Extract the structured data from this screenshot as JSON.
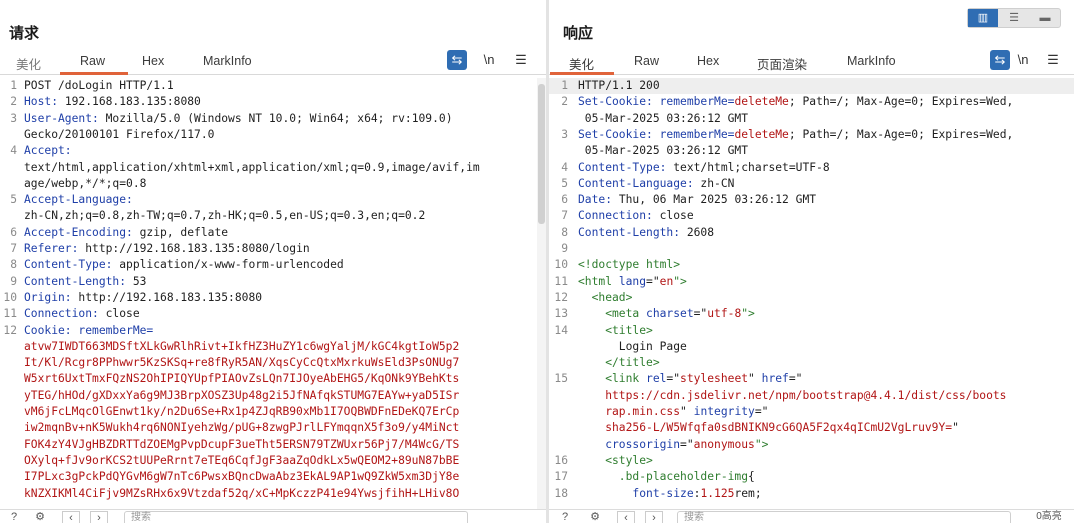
{
  "request": {
    "title": "请求",
    "tabs": [
      {
        "label": "美化",
        "active": false
      },
      {
        "label": "Raw",
        "active": true
      },
      {
        "label": "Hex",
        "active": false
      },
      {
        "label": "MarkInfo",
        "active": false
      }
    ],
    "tools": {
      "wrap_icon": "wrap-lines-icon",
      "newline_label": "\\n",
      "menu_icon": "menu-icon"
    },
    "lines": [
      {
        "n": "1",
        "parts": [
          {
            "t": "POST /doLogin HTTP/1.1",
            "c": "hval"
          }
        ]
      },
      {
        "n": "2",
        "parts": [
          {
            "t": "Host:",
            "c": "hname"
          },
          {
            "t": " 192.168.183.135:8080",
            "c": "hval"
          }
        ]
      },
      {
        "n": "3",
        "parts": [
          {
            "t": "User-Agent:",
            "c": "hname"
          },
          {
            "t": " Mozilla/5.0 (Windows NT 10.0; Win64; x64; rv:109.0)",
            "c": "hval"
          }
        ]
      },
      {
        "n": "",
        "parts": [
          {
            "t": "Gecko/20100101 Firefox/117.0",
            "c": "hval"
          }
        ]
      },
      {
        "n": "4",
        "parts": [
          {
            "t": "Accept:",
            "c": "hname"
          }
        ]
      },
      {
        "n": "",
        "parts": [
          {
            "t": "text/html,application/xhtml+xml,application/xml;q=0.9,image/avif,im",
            "c": "hval"
          }
        ]
      },
      {
        "n": "",
        "parts": [
          {
            "t": "age/webp,*/*;q=0.8",
            "c": "hval"
          }
        ]
      },
      {
        "n": "5",
        "parts": [
          {
            "t": "Accept-Language:",
            "c": "hname"
          }
        ]
      },
      {
        "n": "",
        "parts": [
          {
            "t": "zh-CN,zh;q=0.8,zh-TW;q=0.7,zh-HK;q=0.5,en-US;q=0.3,en;q=0.2",
            "c": "hval"
          }
        ]
      },
      {
        "n": "6",
        "parts": [
          {
            "t": "Accept-Encoding:",
            "c": "hname"
          },
          {
            "t": " gzip, deflate",
            "c": "hval"
          }
        ]
      },
      {
        "n": "7",
        "parts": [
          {
            "t": "Referer:",
            "c": "hname"
          },
          {
            "t": " http://192.168.183.135:8080/login",
            "c": "hval"
          }
        ]
      },
      {
        "n": "8",
        "parts": [
          {
            "t": "Content-Type:",
            "c": "hname"
          },
          {
            "t": " application/x-www-form-urlencoded",
            "c": "hval"
          }
        ]
      },
      {
        "n": "9",
        "parts": [
          {
            "t": "Content-Length:",
            "c": "hname"
          },
          {
            "t": " 53",
            "c": "hval"
          }
        ]
      },
      {
        "n": "10",
        "parts": [
          {
            "t": "Origin:",
            "c": "hname"
          },
          {
            "t": " http://192.168.183.135:8080",
            "c": "hval"
          }
        ]
      },
      {
        "n": "11",
        "parts": [
          {
            "t": "Connection:",
            "c": "hname"
          },
          {
            "t": " close",
            "c": "hval"
          }
        ]
      },
      {
        "n": "12",
        "parts": [
          {
            "t": "Cookie:",
            "c": "hname"
          },
          {
            "t": " rememberMe=",
            "c": "blue"
          }
        ]
      },
      {
        "n": "",
        "parts": [
          {
            "t": "atvw7IWDT663MDSftXLkGwRlhRivt+IkfHZ3HuZY1c6wgYaljM/kGC4kgtIoW5p2",
            "c": "red"
          }
        ]
      },
      {
        "n": "",
        "parts": [
          {
            "t": "It/Kl/Rcgr8PPhwwr5KzSKSq+re8fRyR5AN/XqsCyCcQtxMxrkuWsEld3PsONUg7",
            "c": "red"
          }
        ]
      },
      {
        "n": "",
        "parts": [
          {
            "t": "W5xrt6UxtTmxFQzNS2OhIPIQYUpfPIAOvZsLQn7IJOyeAbEHG5/KqONk9YBehKts",
            "c": "red"
          }
        ]
      },
      {
        "n": "",
        "parts": [
          {
            "t": "yTEG/hHOd/gXDxxYa6g9MJ3BrpXOSZ3Up48g2i5JfNAfqkSTUMG7EAYw+yaD5ISr",
            "c": "red"
          }
        ]
      },
      {
        "n": "",
        "parts": [
          {
            "t": "vM6jFcLMqcOlGEnwt1ky/n2Du6Se+Rx1p4ZJqRB90xMb1I7OQBWDFnEDeKQ7ErCp",
            "c": "red"
          }
        ]
      },
      {
        "n": "",
        "parts": [
          {
            "t": "iw2mqnBv+nK5Wukh4rq6NONIyehzWg/pUG+8zwgPJrlLFYmqqnX5f3o9/y4MiNct",
            "c": "red"
          }
        ]
      },
      {
        "n": "",
        "parts": [
          {
            "t": "FOK4zY4VJgHBZDRTTdZOEMgPvpDcupF3ueTht5ERSN79TZWUxr56Pj7/M4WcG/TS",
            "c": "red"
          }
        ]
      },
      {
        "n": "",
        "parts": [
          {
            "t": "OXylq+fJv9orKCS2tUUPeRrnt7eTEq6CqfJgF3aaZqOdkLx5wQEOM2+89uN87bBE",
            "c": "red"
          }
        ]
      },
      {
        "n": "",
        "parts": [
          {
            "t": "I7PLxc3gPckPdQYGvM6gW7nTc6PwsxBQncDwaAbz3EkAL9AP1wQ9ZkW5xm3DjY8e",
            "c": "red"
          }
        ]
      },
      {
        "n": "",
        "parts": [
          {
            "t": "kNZXIKMl4CiFjv9MZsRHx6x9Vtzdaf52q/xC+MpKczzP41e94YwsjfihH+LHiv8O",
            "c": "red"
          }
        ]
      }
    ],
    "bottom": {
      "help_icon": "help-icon",
      "settings_icon": "gear-icon",
      "back_icon": "chevron-left-icon",
      "forward_icon": "chevron-right-icon",
      "search_placeholder": "搜索"
    }
  },
  "response": {
    "title": "响应",
    "tabs": [
      {
        "label": "美化",
        "active": true
      },
      {
        "label": "Raw",
        "active": false
      },
      {
        "label": "Hex",
        "active": false
      },
      {
        "label": "页面渲染",
        "active": false
      },
      {
        "label": "MarkInfo",
        "active": false
      }
    ],
    "tools": {
      "wrap_icon": "wrap-lines-icon",
      "newline_label": "\\n",
      "menu_icon": "menu-icon"
    },
    "lines": [
      {
        "n": "1",
        "hl": true,
        "parts": [
          {
            "t": "HTTP/1.1 200",
            "c": "hval"
          }
        ]
      },
      {
        "n": "2",
        "parts": [
          {
            "t": "Set-Cookie:",
            "c": "hname"
          },
          {
            "t": " rememberMe=",
            "c": "blue"
          },
          {
            "t": "deleteMe",
            "c": "red"
          },
          {
            "t": "; Path=/; Max-Age=0; Expires=Wed,",
            "c": "hval"
          }
        ]
      },
      {
        "n": "",
        "parts": [
          {
            "t": " 05-Mar-2025 03:26:12 GMT",
            "c": "hval"
          }
        ]
      },
      {
        "n": "3",
        "parts": [
          {
            "t": "Set-Cookie:",
            "c": "hname"
          },
          {
            "t": " rememberMe=",
            "c": "blue"
          },
          {
            "t": "deleteMe",
            "c": "red"
          },
          {
            "t": "; Path=/; Max-Age=0; Expires=Wed,",
            "c": "hval"
          }
        ]
      },
      {
        "n": "",
        "parts": [
          {
            "t": " 05-Mar-2025 03:26:12 GMT",
            "c": "hval"
          }
        ]
      },
      {
        "n": "4",
        "parts": [
          {
            "t": "Content-Type:",
            "c": "hname"
          },
          {
            "t": " text/html;charset=UTF-8",
            "c": "hval"
          }
        ]
      },
      {
        "n": "5",
        "parts": [
          {
            "t": "Content-Language:",
            "c": "hname"
          },
          {
            "t": " zh-CN",
            "c": "hval"
          }
        ]
      },
      {
        "n": "6",
        "parts": [
          {
            "t": "Date:",
            "c": "hname"
          },
          {
            "t": " Thu, 06 Mar 2025 03:26:12 GMT",
            "c": "hval"
          }
        ]
      },
      {
        "n": "7",
        "parts": [
          {
            "t": "Connection:",
            "c": "hname"
          },
          {
            "t": " close",
            "c": "hval"
          }
        ]
      },
      {
        "n": "8",
        "parts": [
          {
            "t": "Content-Length:",
            "c": "hname"
          },
          {
            "t": " 2608",
            "c": "hval"
          }
        ]
      },
      {
        "n": "9",
        "parts": []
      },
      {
        "n": "10",
        "parts": [
          {
            "t": "<!doctype html>",
            "c": "tag"
          }
        ]
      },
      {
        "n": "11",
        "parts": [
          {
            "t": "<html ",
            "c": "tag"
          },
          {
            "t": "lang",
            "c": "attr"
          },
          {
            "t": "=\"",
            "c": "hval"
          },
          {
            "t": "en",
            "c": "aval"
          },
          {
            "t": "\">",
            "c": "tag"
          }
        ]
      },
      {
        "n": "12",
        "parts": [
          {
            "t": "  <head>",
            "c": "tag"
          }
        ]
      },
      {
        "n": "13",
        "parts": [
          {
            "t": "    <meta ",
            "c": "tag"
          },
          {
            "t": "charset",
            "c": "attr"
          },
          {
            "t": "=\"",
            "c": "hval"
          },
          {
            "t": "utf-8",
            "c": "aval"
          },
          {
            "t": "\">",
            "c": "tag"
          }
        ]
      },
      {
        "n": "14",
        "parts": [
          {
            "t": "    <title>",
            "c": "tag"
          }
        ]
      },
      {
        "n": "",
        "parts": [
          {
            "t": "      Login Page",
            "c": "hval"
          }
        ]
      },
      {
        "n": "",
        "parts": [
          {
            "t": "    </title>",
            "c": "tag"
          }
        ]
      },
      {
        "n": "15",
        "parts": [
          {
            "t": "    <link ",
            "c": "tag"
          },
          {
            "t": "rel",
            "c": "attr"
          },
          {
            "t": "=\"",
            "c": "hval"
          },
          {
            "t": "stylesheet",
            "c": "aval"
          },
          {
            "t": "\" ",
            "c": "hval"
          },
          {
            "t": "href",
            "c": "attr"
          },
          {
            "t": "=\"",
            "c": "hval"
          }
        ]
      },
      {
        "n": "",
        "parts": [
          {
            "t": "    https://cdn.jsdelivr.net/npm/bootstrap@4.4.1/dist/css/boots",
            "c": "aval"
          }
        ]
      },
      {
        "n": "",
        "parts": [
          {
            "t": "    rap.min.css",
            "c": "aval"
          },
          {
            "t": "\" ",
            "c": "hval"
          },
          {
            "t": "integrity",
            "c": "attr"
          },
          {
            "t": "=\"",
            "c": "hval"
          }
        ]
      },
      {
        "n": "",
        "parts": [
          {
            "t": "    sha256-L/W5Wfqfa0sdBNIKN9cG6QA5F2qx4qICmU2VgLruv9Y=",
            "c": "aval"
          },
          {
            "t": "\"",
            "c": "hval"
          }
        ]
      },
      {
        "n": "",
        "parts": [
          {
            "t": "    crossorigin",
            "c": "attr"
          },
          {
            "t": "=\"",
            "c": "hval"
          },
          {
            "t": "anonymous",
            "c": "aval"
          },
          {
            "t": "\">",
            "c": "tag"
          }
        ]
      },
      {
        "n": "16",
        "parts": [
          {
            "t": "    <style>",
            "c": "tag"
          }
        ]
      },
      {
        "n": "17",
        "parts": [
          {
            "t": "      .bd-placeholder-img",
            "c": "tag"
          },
          {
            "t": "{",
            "c": "hval"
          }
        ]
      },
      {
        "n": "18",
        "parts": [
          {
            "t": "        font-size",
            "c": "attr"
          },
          {
            "t": ":",
            "c": "hval"
          },
          {
            "t": "1.125",
            "c": "aval"
          },
          {
            "t": "rem;",
            "c": "hval"
          }
        ]
      }
    ],
    "bottom": {
      "help_icon": "help-icon",
      "settings_icon": "gear-icon",
      "back_icon": "chevron-left-icon",
      "forward_icon": "chevron-right-icon",
      "search_placeholder": "搜索",
      "match_label": "0高亮"
    }
  },
  "view_toggle": {
    "modes": [
      "side-by-side-icon",
      "stacked-rows-icon",
      "single-pane-icon"
    ],
    "active": 0
  },
  "colors": {
    "accent": "#e0633a",
    "header_name": "#1f3fa8",
    "value_red": "#b11515",
    "tag_green": "#2f7d2f",
    "button_blue": "#2f6db3"
  }
}
